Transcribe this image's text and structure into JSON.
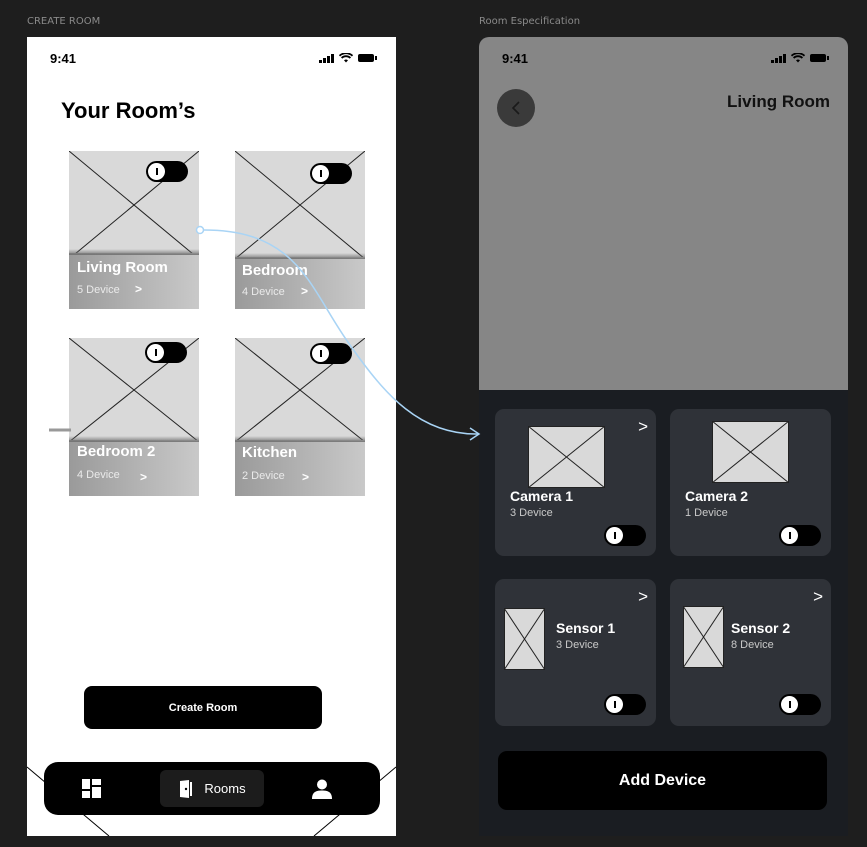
{
  "frames": {
    "left_label": "CREATE ROOM",
    "right_label": "Room Especification"
  },
  "status_bar": {
    "time": "9:41",
    "icons": [
      "signal-icon",
      "wifi-icon",
      "battery-icon"
    ]
  },
  "rooms_screen": {
    "title": "Your Room’s",
    "rooms": [
      {
        "name": "Living Room",
        "count": "5 Device",
        "chevron": ">"
      },
      {
        "name": "Bedroom",
        "count": "4 Device",
        "chevron": ">"
      },
      {
        "name": "Bedroom 2",
        "count": "4 Device",
        "chevron": ">"
      },
      {
        "name": "Kitchen",
        "count": "2 Device",
        "chevron": ">"
      }
    ],
    "create_button": "Create Room",
    "nav": {
      "dashboard_icon": "dashboard-icon",
      "rooms_label": "Rooms",
      "rooms_icon": "door-icon",
      "profile_icon": "user-icon"
    }
  },
  "detail_screen": {
    "room_name": "Living Room",
    "back_icon": "chevron-left-icon",
    "devices": [
      {
        "name": "Camera 1",
        "count": "3 Device",
        "chevron": ">"
      },
      {
        "name": "Camera 2",
        "count": "1 Device",
        "chevron": ">"
      },
      {
        "name": "Sensor 1",
        "count": "3 Device",
        "chevron": ">"
      },
      {
        "name": "Sensor 2",
        "count": "8 Device",
        "chevron": ">"
      }
    ],
    "add_button": "Add Device"
  },
  "colors": {
    "canvas": "#1e1e1e",
    "card_placeholder": "#d9d9d9",
    "device_card": "#2f3238",
    "hero": "#868686",
    "prototype_link": "#a9d4f5"
  }
}
